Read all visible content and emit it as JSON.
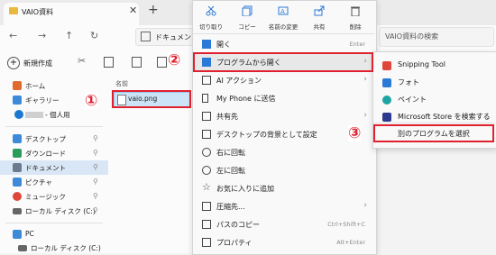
{
  "window": {
    "tab_title": "VAIO資料",
    "tab_close": "✕",
    "tab_add": "+",
    "address_text": "ドキュメント",
    "search_placeholder": "VAIO資料の検索"
  },
  "toolbar": {
    "new_label": "新規作成"
  },
  "sidebar": {
    "items": [
      {
        "label": "ホーム",
        "icon": "home-icon",
        "color": "#e06b2c"
      },
      {
        "label": "ギャラリー",
        "icon": "gallery-icon",
        "color": "#3c8ad8"
      },
      {
        "label": "- 個人用",
        "icon": "onedrive-icon",
        "color": "#1b78d0"
      },
      {
        "label": "デスクトップ",
        "icon": "desktop-icon",
        "color": "#3c8ad8"
      },
      {
        "label": "ダウンロード",
        "icon": "download-icon",
        "color": "#2a9d5b"
      },
      {
        "label": "ドキュメント",
        "icon": "documents-icon",
        "color": "#6b7a8f"
      },
      {
        "label": "ピクチャ",
        "icon": "pictures-icon",
        "color": "#3c8ad8"
      },
      {
        "label": "ミュージック",
        "icon": "music-icon",
        "color": "#e0473c"
      },
      {
        "label": "ローカル ディスク (C:)",
        "icon": "drive-icon",
        "color": "#666666"
      },
      {
        "label": "PC",
        "icon": "pc-icon",
        "color": "#3c8ad8"
      },
      {
        "label": "ローカル ディスク (C:)",
        "icon": "drive-icon",
        "color": "#666666"
      }
    ],
    "pin_glyph": "📌"
  },
  "filepane": {
    "column_name": "名前",
    "file_name": "vaio.png"
  },
  "context_menu": {
    "quick_actions": [
      {
        "label": "切り取り",
        "icon": "cut-icon"
      },
      {
        "label": "コピー",
        "icon": "copy-icon"
      },
      {
        "label": "名前の変更",
        "icon": "rename-icon"
      },
      {
        "label": "共有",
        "icon": "share-icon"
      },
      {
        "label": "削除",
        "icon": "delete-icon"
      }
    ],
    "items": [
      {
        "label": "開く",
        "shortcut": "Enter",
        "icon": "open-icon",
        "color": "#2b79d6"
      },
      {
        "label": "プログラムから開く",
        "arrow": "›",
        "icon": "open-with-icon",
        "color": "#2b79d6"
      },
      {
        "label": "AI アクション",
        "arrow": "›",
        "icon": "ai-actions-icon",
        "color": "#444444"
      },
      {
        "label": "My Phone に送信",
        "icon": "phone-icon",
        "color": "#444444"
      },
      {
        "label": "共有先",
        "arrow": "›",
        "icon": "share-to-icon",
        "color": "#444444"
      },
      {
        "label": "デスクトップの背景として設定",
        "icon": "wallpaper-icon",
        "color": "#444444"
      },
      {
        "label": "右に回転",
        "icon": "rotate-right-icon",
        "color": "#444444"
      },
      {
        "label": "左に回転",
        "icon": "rotate-left-icon",
        "color": "#444444"
      },
      {
        "label": "お気に入りに追加",
        "icon": "star-icon",
        "color": "#444444"
      },
      {
        "label": "圧縮先...",
        "arrow": "›",
        "icon": "zip-icon",
        "color": "#444444"
      },
      {
        "label": "パスのコピー",
        "shortcut": "Ctrl+Shift+C",
        "icon": "copy-path-icon",
        "color": "#444444"
      },
      {
        "label": "プロパティ",
        "shortcut": "Alt+Enter",
        "icon": "properties-icon",
        "color": "#444444"
      }
    ]
  },
  "submenu": {
    "items": [
      {
        "label": "Snipping Tool",
        "icon": "snipping-tool-icon",
        "color": "#e0473c"
      },
      {
        "label": "フォト",
        "icon": "photos-icon",
        "color": "#2b79d6"
      },
      {
        "label": "ペイント",
        "icon": "paint-icon",
        "color": "#1fa3a3"
      },
      {
        "label": "Microsoft Store を検索する",
        "icon": "store-icon",
        "color": "#2b3a8f"
      },
      {
        "label": "別のプログラムを選択",
        "icon": "",
        "color": ""
      }
    ]
  },
  "annotations": {
    "marker1": "①",
    "marker2": "②",
    "marker3": "③",
    "color": "#e0212e"
  }
}
